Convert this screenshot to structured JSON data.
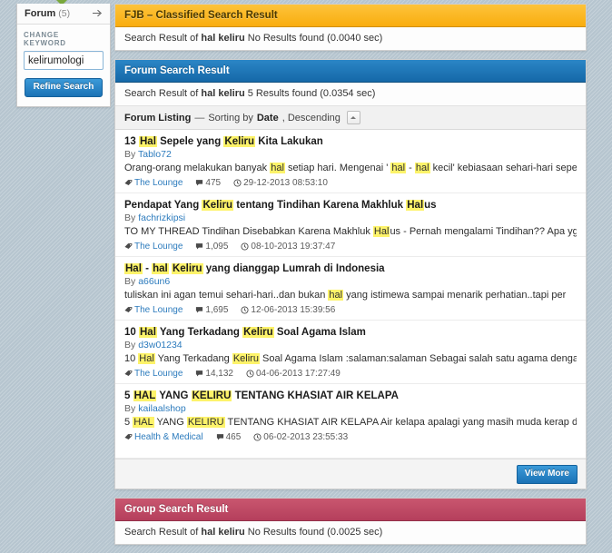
{
  "sidebar": {
    "header_title": "Forum",
    "header_count": "(5)",
    "header_arrow_icon": "arrow-right-icon",
    "change_keyword_label": "CHANGE KEYWORD",
    "keyword_value": "kelirumologi",
    "keyword_placeholder": "",
    "refine_button_label": "Refine Search"
  },
  "panels": {
    "fjb": {
      "title": "FJB – Classified Search Result",
      "summary_prefix": "Search Result of",
      "summary_keyword": "hal keliru",
      "summary_suffix": "No Results found (0.0040 sec)",
      "header_color": "#f9ad0e"
    },
    "forum": {
      "title": "Forum Search Result",
      "summary_prefix": "Search Result of",
      "summary_keyword": "hal keliru",
      "summary_suffix": "5 Results found (0.0354 sec)",
      "header_color": "#1568a8",
      "listing_label": "Forum Listing",
      "listing_dash": "—",
      "listing_sorting_text": "Sorting by",
      "listing_sort_field": "Date",
      "listing_sort_dir": ", Descending",
      "sort_toggle_icon": "caret-up-icon",
      "view_more_label": "View More"
    },
    "group": {
      "title": "Group Search Result",
      "summary_prefix": "Search Result of",
      "summary_keyword": "hal keliru",
      "summary_suffix": "No Results found (0.0025 sec)",
      "header_color": "#b53f5c"
    }
  },
  "results": [
    {
      "title_parts": [
        {
          "t": "13 ",
          "hl": false
        },
        {
          "t": "Hal",
          "hl": true
        },
        {
          "t": " Sepele yang ",
          "hl": false
        },
        {
          "t": "Keliru",
          "hl": true
        },
        {
          "t": " Kita Lakukan",
          "hl": false
        }
      ],
      "by_label": "By",
      "author": "Tablo72",
      "snippet_parts": [
        {
          "t": "Orang-orang melakukan banyak ",
          "hl": false
        },
        {
          "t": "hal",
          "hl": true
        },
        {
          "t": " setiap hari. Mengenai ' ",
          "hl": false
        },
        {
          "t": "hal",
          "hl": true
        },
        {
          "t": " - ",
          "hl": false
        },
        {
          "t": "hal",
          "hl": true
        },
        {
          "t": " kecil' kebiasaan sehari-hari sepert",
          "hl": false
        }
      ],
      "forum": "The Lounge",
      "replies": "475",
      "date": "29-12-2013 08:53:10"
    },
    {
      "title_parts": [
        {
          "t": "Pendapat Yang ",
          "hl": false
        },
        {
          "t": "Keliru",
          "hl": true
        },
        {
          "t": " tentang Tindihan Karena Makhluk ",
          "hl": false
        },
        {
          "t": "Hal",
          "hl": true
        },
        {
          "t": "us",
          "hl": false
        }
      ],
      "by_label": "By",
      "author": "fachrizkipsi",
      "snippet_parts": [
        {
          "t": "TO MY THREAD Tindihan Disebabkan Karena Makhluk ",
          "hl": false
        },
        {
          "t": "Hal",
          "hl": true
        },
        {
          "t": "us - Pernah mengalami Tindihan?? Apa yg terjadi",
          "hl": false
        }
      ],
      "forum": "The Lounge",
      "replies": "1,095",
      "date": "08-10-2013 19:37:47"
    },
    {
      "title_parts": [
        {
          "t": "Hal",
          "hl": true
        },
        {
          "t": " - ",
          "hl": false
        },
        {
          "t": "hal",
          "hl": true
        },
        {
          "t": " ",
          "hl": false
        },
        {
          "t": "Keliru",
          "hl": true
        },
        {
          "t": " yang dianggap Lumrah di Indonesia",
          "hl": false
        }
      ],
      "by_label": "By",
      "author": "a66un6",
      "snippet_parts": [
        {
          "t": "tuliskan ini agan temui sehari-hari..dan bukan ",
          "hl": false
        },
        {
          "t": "hal",
          "hl": true
        },
        {
          "t": " yang istimewa sampai menarik perhatian..tapi per",
          "hl": false
        }
      ],
      "forum": "The Lounge",
      "replies": "1,695",
      "date": "12-06-2013 15:39:56"
    },
    {
      "title_parts": [
        {
          "t": "10 ",
          "hl": false
        },
        {
          "t": "Hal",
          "hl": true
        },
        {
          "t": " Yang Terkadang ",
          "hl": false
        },
        {
          "t": "Keliru",
          "hl": true
        },
        {
          "t": " Soal Agama Islam",
          "hl": false
        }
      ],
      "by_label": "By",
      "author": "d3w01234",
      "snippet_parts": [
        {
          "t": "10 ",
          "hl": false
        },
        {
          "t": "Hal",
          "hl": true
        },
        {
          "t": " Yang Terkadang ",
          "hl": false
        },
        {
          "t": "Keliru",
          "hl": true
        },
        {
          "t": " Soal Agama Islam :salaman:salaman Sebagai salah satu agama dengan juml",
          "hl": false
        }
      ],
      "forum": "The Lounge",
      "replies": "14,132",
      "date": "04-06-2013 17:27:49"
    },
    {
      "title_parts": [
        {
          "t": "5 ",
          "hl": false
        },
        {
          "t": "HAL",
          "hl": true
        },
        {
          "t": " YANG ",
          "hl": false
        },
        {
          "t": "KELIRU",
          "hl": true
        },
        {
          "t": " TENTANG KHASIAT AIR KELAPA",
          "hl": false
        }
      ],
      "by_label": "By",
      "author": "kailaalshop",
      "snippet_parts": [
        {
          "t": "5 ",
          "hl": false
        },
        {
          "t": "HAL",
          "hl": true
        },
        {
          "t": " YANG ",
          "hl": false
        },
        {
          "t": "KELIRU",
          "hl": true
        },
        {
          "t": " TENTANG KHASIAT AIR KELAPA Air kelapa apalagi yang masih muda kerap dijadikan min",
          "hl": false
        }
      ],
      "forum": "Health & Medical",
      "replies": "465",
      "date": "06-02-2013 23:55:33"
    }
  ],
  "icons": {
    "tag": "tag-icon",
    "comment": "comment-icon",
    "clock": "clock-icon"
  }
}
